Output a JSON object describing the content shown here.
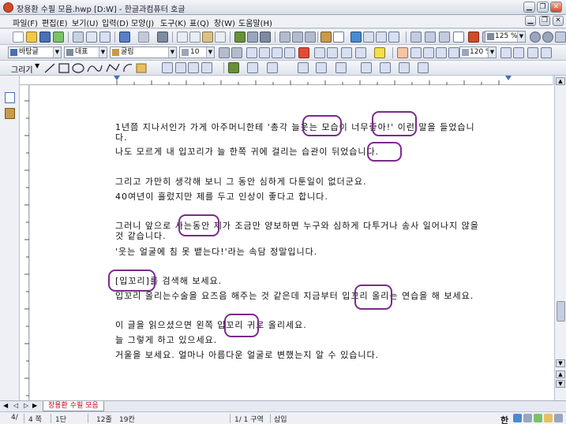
{
  "window": {
    "title": "장용환 수필 모음.hwp [D:W] - 한글과컴퓨터 호글",
    "controls": {
      "minimize": "▁",
      "restore": "❐",
      "close": "✕"
    }
  },
  "menu": [
    "파일(F)",
    "편집(E)",
    "보기(U)",
    "입력(D)",
    "모양(J)",
    "도구(K)",
    "표(Q)",
    "창(W)",
    "도움말(H)"
  ],
  "toolbar_main": {
    "zoom": "125 %"
  },
  "toolbar_format": {
    "style": "바탕글",
    "font_type": "대표",
    "font": "굴림",
    "size": "10",
    "spacing": "120 %"
  },
  "toolbar_draw": {
    "label": "그리기"
  },
  "document": {
    "lines": [
      "1년쯤 지나서인가 가게 아주머니한테 '총각 늘웃는 모습이 너무좋아!' 이런 말을 들었습니",
      "다.",
      "나도 모르게 내 입꼬리가 늘 한쪽 귀에 걸리는 습관이 뒤었습니다.",
      "그리고 가만히 생각해 보니 그 동안 심하게 다툰일이 없더군요.",
      "40여년이 흘렀지만 제를 두고 인상이 좋다고 합니다.",
      "그러니 앞으로 사는동안 제가 조금만 양보하면 누구와 심하게 다투거나 송사 일어나지 않을",
      "것 같습니다.",
      "'웃는 얼굴에 침 못 뱉는다!'라는 속담 정말입니다.",
      "[입꼬리]를 검색해 보세요.",
      "입꼬리 올리는수술을 요즈음 해주는 것 같은데 지금부터 입꼬리 올리는 연습을 해 보세요.",
      "이 글을 읽으셨으면 왼쪽 입꼬리 귀로 올리세요.",
      "늘 그렇게 하고 있으세요.",
      "거울을 보세요. 얼마나 아름다운 얼굴로 변했는지 알 수 있습니다."
    ]
  },
  "tabs": {
    "active": "장용환 수필 모음"
  },
  "status": {
    "page": "4/",
    "total": "4 쪽",
    "col": "1단",
    "line": "12줄",
    "char": "19칸",
    "section": "1/  1 구역",
    "mode": "삽입"
  },
  "ime": {
    "label": "한"
  },
  "colors": {
    "annotation": "#7a2b8c",
    "tab_text": "#c8001e",
    "accent": "#d24a2a"
  }
}
